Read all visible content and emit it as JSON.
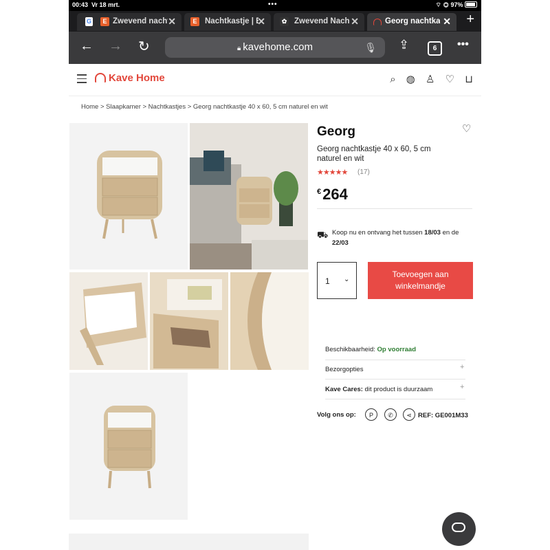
{
  "status_bar": {
    "time": "00:43",
    "date": "Vr 18 mrt.",
    "battery": "97%"
  },
  "tabs": [
    {
      "title": "Zwevend nachtkastje",
      "favicon": "E",
      "favicon_color": "#e8612c"
    },
    {
      "title": "Nachtkastje | Etsy",
      "favicon": "E",
      "favicon_color": "#e8612c"
    },
    {
      "title": "Zwevend Nachtkastje",
      "favicon": "",
      "favicon_color": "#333333"
    },
    {
      "title": "Georg nachtkastje",
      "favicon": "",
      "favicon_color": "#e2473b"
    }
  ],
  "toolbar": {
    "url": "kavehome.com",
    "tab_count": "6"
  },
  "site": {
    "brand": "Kave Home",
    "brand_color": "#e2473b"
  },
  "breadcrumb": "Home > Slaapkamer > Nachtkastjes > Georg nachtkastje 40 x 60, 5 cm naturel en wit",
  "product": {
    "name": "Georg",
    "description": "Georg nachtkastje 40 x 60, 5 cm naturel en wit",
    "rating_stars": "★★★★★",
    "reviews": "(17)",
    "currency": "€",
    "price": "264",
    "delivery_prefix": "Koop nu en ontvang het tussen ",
    "delivery_from": "18/03",
    "delivery_mid": " en de ",
    "delivery_to": "22/03",
    "quantity": "1",
    "add_to_cart": "Toevoegen aan winkelmandje",
    "availability_label": "Beschikbaarheid: ",
    "availability_value": "Op voorraad",
    "shipping_options": "Bezorgopties",
    "cares_label": "Kave Cares:",
    "cares_text": " dit product is duurzaam",
    "follow_label": "Volg ons op:",
    "ref": "REF: GE001M33"
  },
  "colors": {
    "accent": "#e84a45",
    "in_stock": "#2e7d32"
  }
}
